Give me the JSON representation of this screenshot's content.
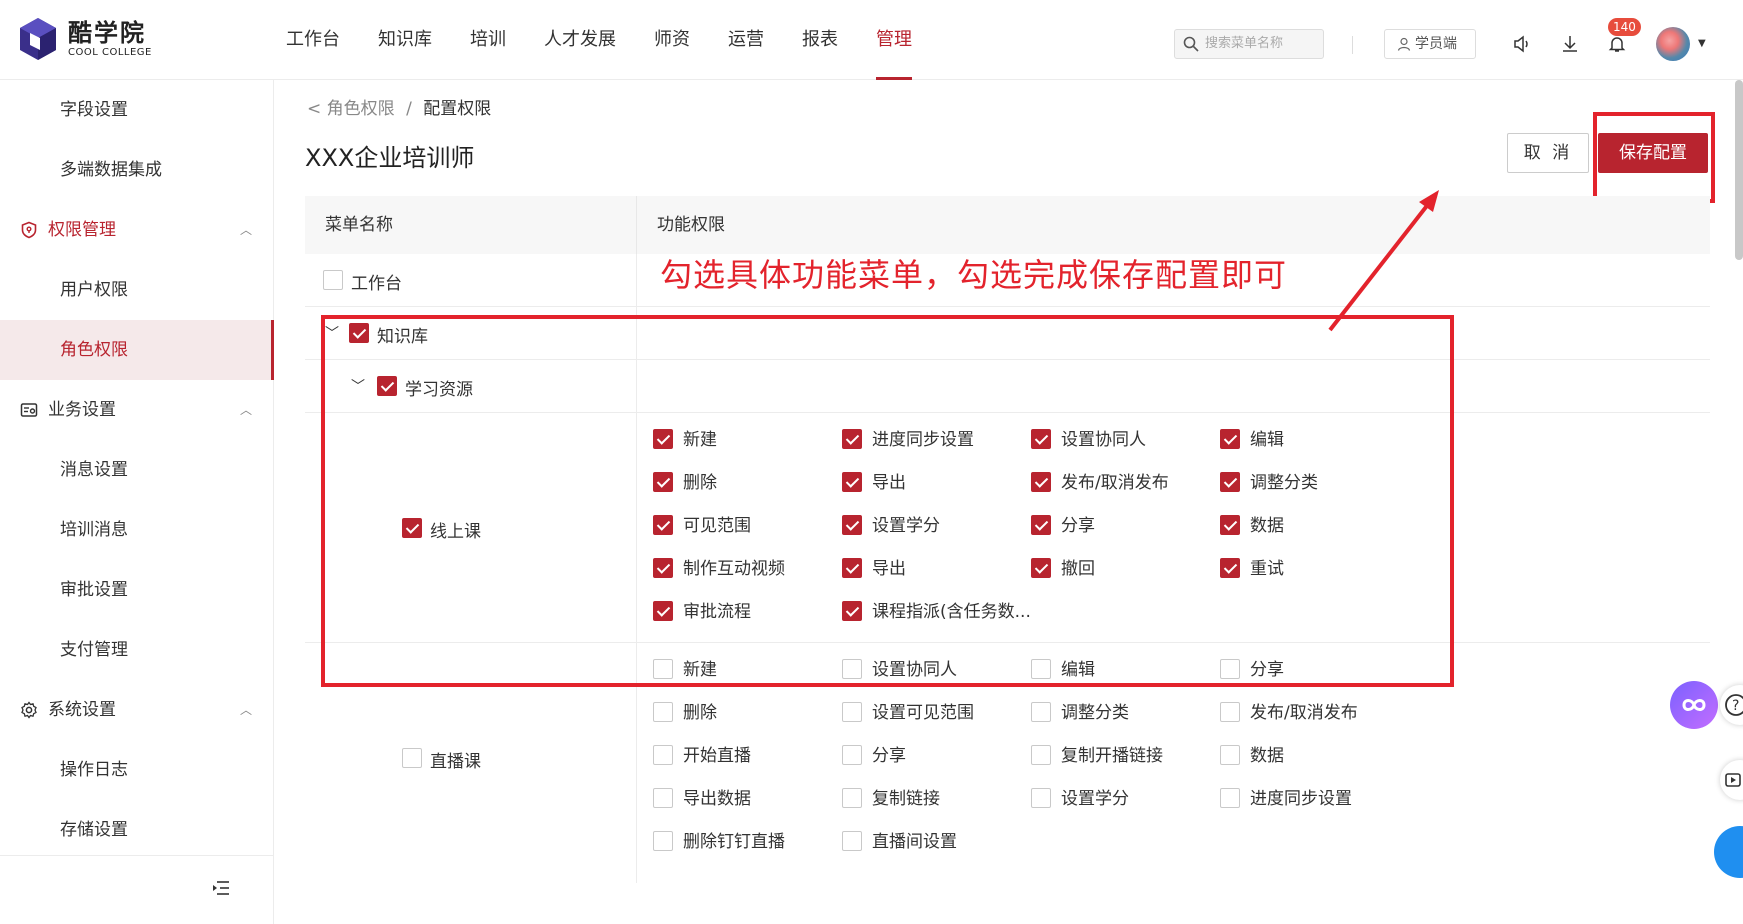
{
  "brand": {
    "name_cn": "酷学院",
    "name_en": "COOL COLLEGE"
  },
  "nav": [
    {
      "label": "工作台"
    },
    {
      "label": "知识库"
    },
    {
      "label": "培训"
    },
    {
      "label": "人才发展"
    },
    {
      "label": "师资"
    },
    {
      "label": "运营"
    },
    {
      "label": "报表"
    },
    {
      "label": "管理",
      "active": true
    }
  ],
  "search": {
    "placeholder": "搜索菜单名称"
  },
  "student_btn": "学员端",
  "notification_count": "140",
  "sidebar": {
    "items": [
      {
        "label": "字段设置"
      },
      {
        "label": "多端数据集成"
      },
      {
        "label": "权限管理",
        "group": true,
        "icon": "shield-icon"
      },
      {
        "label": "用户权限"
      },
      {
        "label": "角色权限",
        "selected": true
      },
      {
        "label": "业务设置",
        "group": true,
        "icon": "business-settings-icon"
      },
      {
        "label": "消息设置"
      },
      {
        "label": "培训消息"
      },
      {
        "label": "审批设置"
      },
      {
        "label": "支付管理"
      },
      {
        "label": "系统设置",
        "group": true,
        "icon": "gear-icon"
      },
      {
        "label": "操作日志"
      },
      {
        "label": "存储设置"
      }
    ]
  },
  "breadcrumb": {
    "parent": "角色权限",
    "separator": "/",
    "current": "配置权限"
  },
  "page_title": "XXX企业培训师",
  "buttons": {
    "cancel": "取 消",
    "save": "保存配置"
  },
  "table": {
    "col_menu": "菜单名称",
    "col_perm": "功能权限",
    "rows": {
      "workbench": {
        "label": "工作台",
        "checked": false
      },
      "knowledge": {
        "label": "知识库",
        "checked": true
      },
      "learning": {
        "label": "学习资源",
        "checked": true
      },
      "online": {
        "label": "线上课",
        "checked": true,
        "perms": [
          "新建",
          "进度同步设置",
          "设置协同人",
          "编辑",
          "删除",
          "导出",
          "发布/取消发布",
          "调整分类",
          "可见范围",
          "设置学分",
          "分享",
          "数据",
          "制作互动视频",
          "导出",
          "撤回",
          "重试",
          "审批流程",
          "课程指派(含任务数..."
        ]
      },
      "live": {
        "label": "直播课",
        "checked": false,
        "perms": [
          "新建",
          "设置协同人",
          "编辑",
          "分享",
          "删除",
          "设置可见范围",
          "调整分类",
          "发布/取消发布",
          "开始直播",
          "分享",
          "复制开播链接",
          "数据",
          "导出数据",
          "复制链接",
          "设置学分",
          "进度同步设置",
          "删除钉钉直播",
          "直播间设置"
        ]
      }
    }
  },
  "annotation": "勾选具体功能菜单，勾选完成保存配置即可",
  "colors": {
    "accent": "#b8242f",
    "annotation_red": "#e3232c"
  }
}
